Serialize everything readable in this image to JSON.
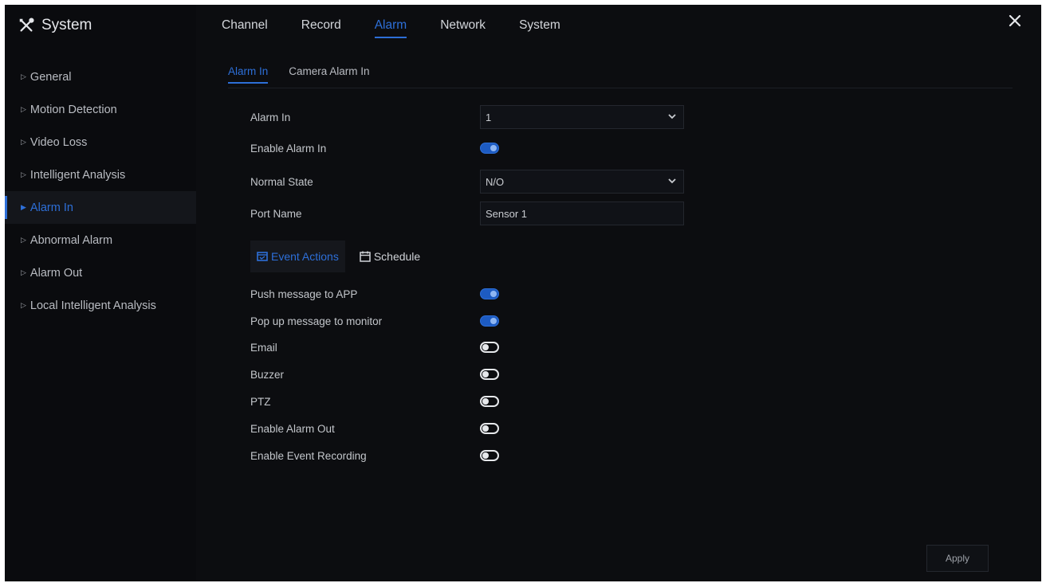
{
  "brand": {
    "title": "System"
  },
  "topnav": {
    "tabs": [
      {
        "label": "Channel"
      },
      {
        "label": "Record"
      },
      {
        "label": "Alarm"
      },
      {
        "label": "Network"
      },
      {
        "label": "System"
      }
    ],
    "active": "Alarm"
  },
  "sidebar": {
    "items": [
      {
        "label": "General"
      },
      {
        "label": "Motion Detection"
      },
      {
        "label": "Video Loss"
      },
      {
        "label": "Intelligent Analysis"
      },
      {
        "label": "Alarm In"
      },
      {
        "label": "Abnormal Alarm"
      },
      {
        "label": "Alarm Out"
      },
      {
        "label": "Local Intelligent Analysis"
      }
    ],
    "active": "Alarm In"
  },
  "subtabs": {
    "items": [
      {
        "label": "Alarm In"
      },
      {
        "label": "Camera Alarm In"
      }
    ],
    "active": "Alarm In"
  },
  "form": {
    "alarm_in": {
      "label": "Alarm In",
      "value": "1"
    },
    "enable_alarm_in": {
      "label": "Enable Alarm In",
      "state": "on"
    },
    "normal_state": {
      "label": "Normal State",
      "value": "N/O"
    },
    "port_name": {
      "label": "Port Name",
      "value": "Sensor 1"
    }
  },
  "event_tabs": {
    "items": [
      {
        "label": "Event Actions",
        "icon": "event-actions-icon"
      },
      {
        "label": "Schedule",
        "icon": "calendar-icon"
      }
    ],
    "active": "Event Actions"
  },
  "actions": {
    "items": [
      {
        "label": "Push message to APP",
        "state": "on"
      },
      {
        "label": "Pop up message to monitor",
        "state": "on"
      },
      {
        "label": "Email",
        "state": "off"
      },
      {
        "label": "Buzzer",
        "state": "off"
      },
      {
        "label": "PTZ",
        "state": "off"
      },
      {
        "label": "Enable Alarm Out",
        "state": "off"
      },
      {
        "label": "Enable Event Recording",
        "state": "off"
      }
    ]
  },
  "footer": {
    "apply_label": "Apply"
  },
  "colors": {
    "accent": "#2d6fd8",
    "background": "#0c0d10",
    "toggle_on": "#1d5bc2",
    "toggle_off": "#e6e8eb"
  }
}
